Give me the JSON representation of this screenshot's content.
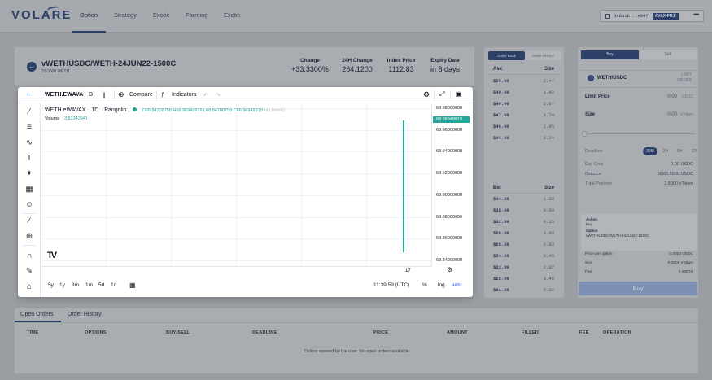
{
  "app": {
    "logo": "VOLARE",
    "nav": [
      "Option",
      "Strategy",
      "Exotic",
      "Farming",
      "Exotic"
    ],
    "wallet_address": "0x8a1b...e04f",
    "network": "AVAX-FUJI",
    "more": "•••"
  },
  "header": {
    "back_icon": "arrow-left-icon",
    "pair": "vWETHUSDC/WETH-24JUN22-1500C",
    "sub": "31.0000 WETH",
    "stats": [
      {
        "label": "Change",
        "value": "+33.3300%"
      },
      {
        "label": "24H Change",
        "value": "264.1200"
      },
      {
        "label": "Index Price",
        "value": "1112.83"
      },
      {
        "label": "Expiry Date",
        "value": "in 8 days"
      }
    ]
  },
  "orderbook": {
    "tabs": [
      "Order Book",
      "Order History"
    ],
    "ask_header": [
      "Ask",
      "Size"
    ],
    "asks": [
      [
        "$50.00",
        "2.47"
      ],
      [
        "$49.00",
        "1.42"
      ],
      [
        "$48.00",
        "2.67"
      ],
      [
        "$47.00",
        "1.74"
      ],
      [
        "$46.00",
        "1.85"
      ],
      [
        "$44.00",
        "0.34"
      ]
    ],
    "bid_header": [
      "Bid",
      "Size"
    ],
    "bids": [
      [
        "$44.00",
        "1.08"
      ],
      [
        "$35.00",
        "0.60"
      ],
      [
        "$32.00",
        "6.15"
      ],
      [
        "$26.00",
        "3.08"
      ],
      [
        "$25.00",
        "2.93"
      ],
      [
        "$24.00",
        "0.45"
      ],
      [
        "$23.00",
        "2.02"
      ],
      [
        "$22.00",
        "3.46"
      ],
      [
        "$21.00",
        "5.02"
      ]
    ]
  },
  "trade": {
    "tabs": [
      "Buy",
      "Sell"
    ],
    "asset": "WETH/USDC",
    "order_type": "LIMIT ORDER",
    "limit_price": {
      "label": "Limit Price",
      "value": "0.00",
      "unit": "USDC"
    },
    "size": {
      "label": "Size",
      "value": "0.00",
      "unit": "vToken"
    },
    "deadline_label": "Deadline",
    "deadline_opts": [
      "30M",
      "2H",
      "6H",
      "1D"
    ],
    "deadline_selected": "30M",
    "info": [
      {
        "label": "Est. Cost",
        "value": "0.00 USDC"
      },
      {
        "label": "Balance",
        "value": "9065.5900 USDC"
      },
      {
        "label": "Total Position",
        "value": "2.8900 vToken"
      }
    ],
    "summary": {
      "action_label": "Action",
      "action": "Buy",
      "option_label": "Option",
      "option": "vWETHUSDC/WETH-24JUN22-1500C"
    },
    "fees": [
      {
        "label": "Price per option",
        "value": "0.0000 USDC"
      },
      {
        "label": "Size",
        "value": "0.0000 vToken"
      },
      {
        "label": "Fee",
        "value": "0 WETH"
      }
    ],
    "buy_button": "Buy"
  },
  "orders": {
    "tabs": [
      "Open Orders",
      "Order History"
    ],
    "columns": [
      "TIME",
      "OPTIONS",
      "BUY/SELL",
      "DEADLINE",
      "PRICE",
      "AMOUNT",
      "FILLED",
      "FEE",
      "OPERATION"
    ],
    "empty": "Orders opened by the user. No open orders available."
  },
  "chart": {
    "symbol": "WETH.EWAVA",
    "interval": "D",
    "compare": "Compare",
    "indicators": "Indicators",
    "legend_title": "WETH.eWAVAX",
    "legend_interval": "1D",
    "legend_exchange": "Pangolin",
    "ohlc": "O68.84708758  H68.96949919  L68.84708758  C68.96949919",
    "ohlc_na": "n/a (n/a%)",
    "volume_label": "Volume",
    "volume_value": "3.63342941",
    "current_price": "68.96949919",
    "yticks": [
      "68.98000000",
      "68.96000000",
      "68.94000000",
      "68.92000000",
      "68.90000000",
      "68.88000000",
      "68.86000000",
      "68.84000000"
    ],
    "xtick": "17",
    "ranges": [
      "5y",
      "1y",
      "3m",
      "1m",
      "5d",
      "1d"
    ],
    "time": "11:39:59 (UTC)",
    "percent": "%",
    "log": "log",
    "auto": "auto",
    "accent": "#26a69a"
  },
  "chart_data": {
    "type": "candlestick",
    "x": [
      "17"
    ],
    "open": [
      68.84708758
    ],
    "high": [
      68.96949919
    ],
    "low": [
      68.84708758
    ],
    "close": [
      68.96949919
    ],
    "volume": [
      3.63342941
    ],
    "ylim": [
      68.835,
      68.985
    ],
    "grid": true
  }
}
